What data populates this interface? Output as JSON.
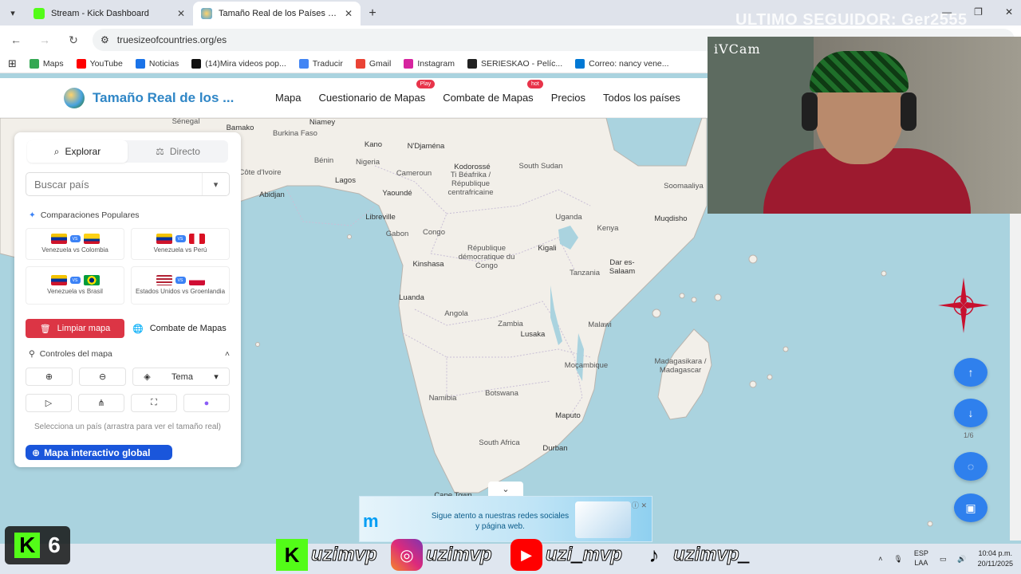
{
  "browser": {
    "tabs": [
      {
        "title": "Stream - Kick Dashboard",
        "active": false
      },
      {
        "title": "Tamaño Real de los Países | Cor",
        "active": true
      }
    ],
    "url": "truesizeofcountries.org/es",
    "bookmarks": [
      {
        "label": "Maps",
        "color": "#34a853"
      },
      {
        "label": "YouTube",
        "color": "#ff0000"
      },
      {
        "label": "Noticias",
        "color": "#1a73e8"
      },
      {
        "label": "(14)Mira videos pop...",
        "color": "#111111"
      },
      {
        "label": "Traducir",
        "color": "#4285f4"
      },
      {
        "label": "Gmail",
        "color": "#ea4335"
      },
      {
        "label": "Instagram",
        "color": "#d6249f"
      },
      {
        "label": "SERIESKAO - Pelíc...",
        "color": "#222222"
      },
      {
        "label": "Correo: nancy vene...",
        "color": "#0078d4"
      }
    ]
  },
  "site": {
    "logo_text": "Tamaño Real de los ...",
    "nav": [
      {
        "label": "Mapa",
        "badge": ""
      },
      {
        "label": "Cuestionario de Mapas",
        "badge": "Play"
      },
      {
        "label": "Combate de Mapas",
        "badge": "hot"
      },
      {
        "label": "Precios",
        "badge": ""
      },
      {
        "label": "Todos los países",
        "badge": ""
      }
    ]
  },
  "panel": {
    "tab_explore": "Explorar",
    "tab_direct": "Directo",
    "search_placeholder": "Buscar país",
    "popular_title": "Comparaciones Populares",
    "comparisons": [
      {
        "label": "Venezuela vs Colombia"
      },
      {
        "label": "Venezuela vs Perú"
      },
      {
        "label": "Venezuela vs Brasil"
      },
      {
        "label": "Estados Unidos vs Groenlandia"
      }
    ],
    "vs_badge": "VS",
    "clear_button": "Limpiar mapa",
    "combat_button": "Combate de Mapas",
    "controls_title": "Controles del mapa",
    "theme_label": "Tema",
    "hint": "Selecciona un país (arrastra para ver el tamaño real)",
    "global_button": "Mapa interactivo global"
  },
  "map_labels": [
    {
      "text": "Sénegal"
    },
    {
      "text": "Bamako"
    },
    {
      "text": "Niamey"
    },
    {
      "text": "Burkina Faso"
    },
    {
      "text": "Nigeria"
    },
    {
      "text": "Kano"
    },
    {
      "text": "N'Djaména"
    },
    {
      "text": "Bénin"
    },
    {
      "text": "Côte d'Ivoire"
    },
    {
      "text": "Lagos"
    },
    {
      "text": "Abidjan"
    },
    {
      "text": "Cameroun"
    },
    {
      "text": "Yaoundé"
    },
    {
      "text": "Libreville"
    },
    {
      "text": "Gabon"
    },
    {
      "text": "Congo"
    },
    {
      "text": "Kinshasa"
    },
    {
      "text": "South Sudan"
    },
    {
      "text": "Kodorossé"
    },
    {
      "text": "Ti Béafrika / République centrafricaine"
    },
    {
      "text": "République démocratique du Congo"
    },
    {
      "text": "Uganda"
    },
    {
      "text": "Kenya"
    },
    {
      "text": "Kigali"
    },
    {
      "text": "Soomaaliya"
    },
    {
      "text": "Muqdisho"
    },
    {
      "text": "Dar es-Salaam"
    },
    {
      "text": "Tanzania"
    },
    {
      "text": "Luanda"
    },
    {
      "text": "Angola"
    },
    {
      "text": "Zambia"
    },
    {
      "text": "Lusaka"
    },
    {
      "text": "Malawi"
    },
    {
      "text": "Moçambique"
    },
    {
      "text": "Madagasikara / Madagascar"
    },
    {
      "text": "Namibia"
    },
    {
      "text": "Botswana"
    },
    {
      "text": "Maputo"
    },
    {
      "text": "South Africa"
    },
    {
      "text": "Durban"
    },
    {
      "text": "Cape Town"
    }
  ],
  "map_controls": {
    "page_indicator": "1/6"
  },
  "ad": {
    "brand": "m",
    "text": "Sigue atento a nuestras redes sociales y página web."
  },
  "stream": {
    "last_follower": "ULTIMO SEGUIDOR: Ger2555",
    "cam_label": "iVCam",
    "kick_count": "6",
    "handles": [
      "uzimvp",
      "uzimvp",
      "uzi_mvp",
      "uzimvp_"
    ]
  },
  "taskbar": {
    "lang_top": "ESP",
    "lang_bottom": "LAA",
    "time": "10:04 p.m.",
    "date": "20/11/2025"
  },
  "colors": {
    "accent": "#2f80ed",
    "danger": "#dc3545",
    "brand": "#2f86c6",
    "water": "#aad3df",
    "land": "#f2efe9"
  }
}
